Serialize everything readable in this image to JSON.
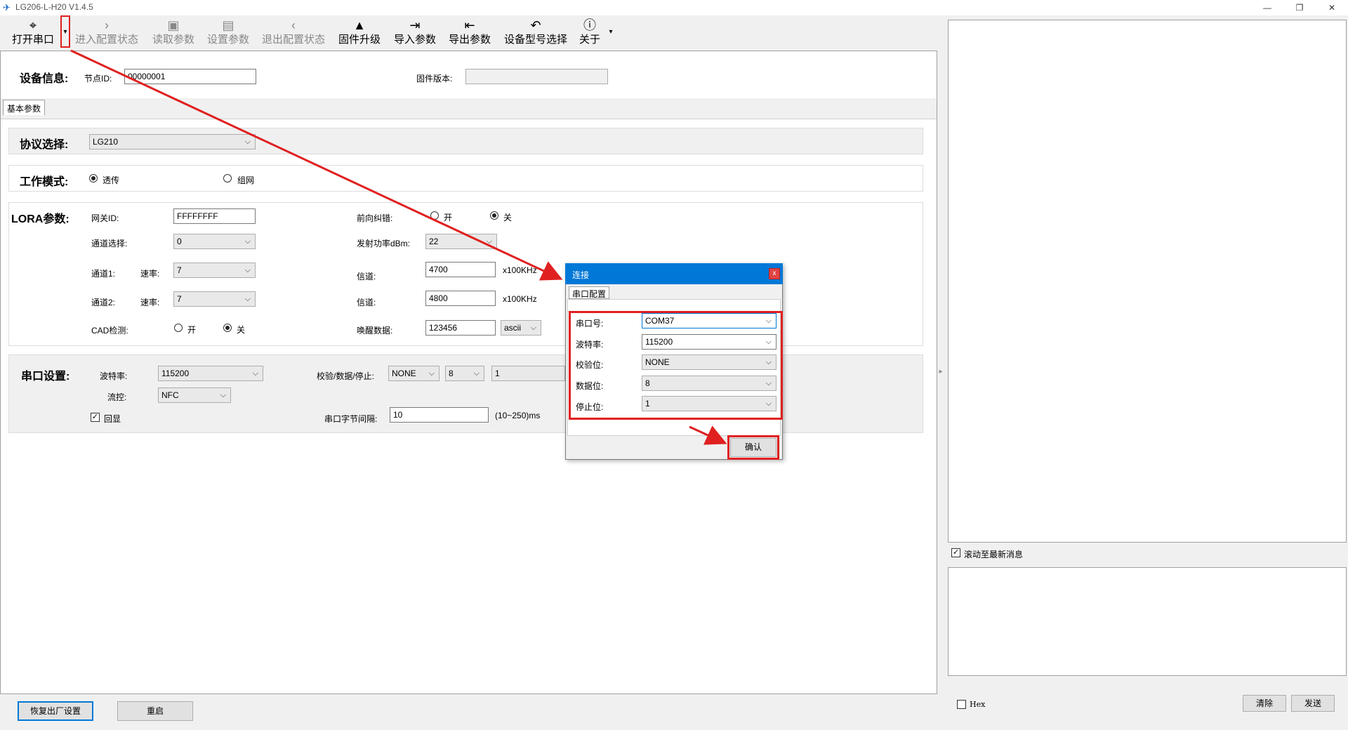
{
  "window": {
    "title": "LG206-L-H20 V1.4.5",
    "minimize": "—",
    "restore": "❐",
    "close": "✕"
  },
  "toolbar": {
    "open_port": "打开串口",
    "enter_config": "进入配置状态",
    "read_params": "读取参数",
    "set_params": "设置参数",
    "exit_config": "退出配置状态",
    "firmware_upgrade": "固件升级",
    "import_params": "导入参数",
    "export_params": "导出参数",
    "model_select": "设备型号选择",
    "about": "关于"
  },
  "device_info": {
    "title": "设备信息:",
    "node_id_label": "节点ID:",
    "node_id": "00000001",
    "firmware_label": "固件版本:",
    "firmware": ""
  },
  "tabs": {
    "basic": "基本参数"
  },
  "protocol": {
    "title": "协议选择:",
    "value": "LG210"
  },
  "work_mode": {
    "title": "工作模式:",
    "transparent": "透传",
    "network": "组网",
    "selected": "透传"
  },
  "lora": {
    "title": "LORA参数:",
    "gateway_id_label": "网关ID:",
    "gateway_id": "FFFFFFFF",
    "channel_select_label": "通道选择:",
    "channel_select": "0",
    "ch1_label": "通道1:",
    "ch1_rate_label": "速率:",
    "ch1_rate": "7",
    "ch2_label": "通道2:",
    "ch2_rate_label": "速率:",
    "ch2_rate": "7",
    "cad_label": "CAD检测:",
    "cad_on": "开",
    "cad_off": "关",
    "fec_label": "前向纠错:",
    "fec_on": "开",
    "fec_off": "关",
    "tx_power_label": "发射功率dBm:",
    "tx_power": "22",
    "ch1_freq_label": "信道:",
    "ch1_freq": "4700",
    "ch1_unit": "x100KHz",
    "ch2_freq_label": "信道:",
    "ch2_freq": "4800",
    "ch2_unit": "x100KHz",
    "wake_label": "唤醒数据:",
    "wake_data": "123456",
    "wake_format": "ascii"
  },
  "serial": {
    "title": "串口设置:",
    "baud_label": "波特率:",
    "baud": "115200",
    "flow_label": "流控:",
    "flow": "NFC",
    "echo_label": "回显",
    "echo": true,
    "parity_label": "校验/数据/停止:",
    "parity": "NONE",
    "databits": "8",
    "stopbits": "1",
    "byte_interval_label": "串口字节间隔:",
    "byte_interval": "10",
    "byte_interval_unit": "(10~250)ms"
  },
  "bottom": {
    "factory_reset": "恢复出厂设置",
    "restart": "重启"
  },
  "right": {
    "autoscroll_label": "滚动至最新消息",
    "autoscroll": true,
    "hex_label": "Hex",
    "clear": "清除",
    "send": "发送"
  },
  "dialog": {
    "title": "连接",
    "close": "x",
    "tab": "串口配置",
    "port_label": "串口号:",
    "port": "COM37",
    "baud_label": "波特率:",
    "baud": "115200",
    "parity_label": "校验位:",
    "parity": "NONE",
    "databits_label": "数据位:",
    "databits": "8",
    "stopbits_label": "停止位:",
    "stopbits": "1",
    "confirm": "确认"
  },
  "colors": {
    "accent": "#0078d7",
    "highlight": "#e02020"
  }
}
